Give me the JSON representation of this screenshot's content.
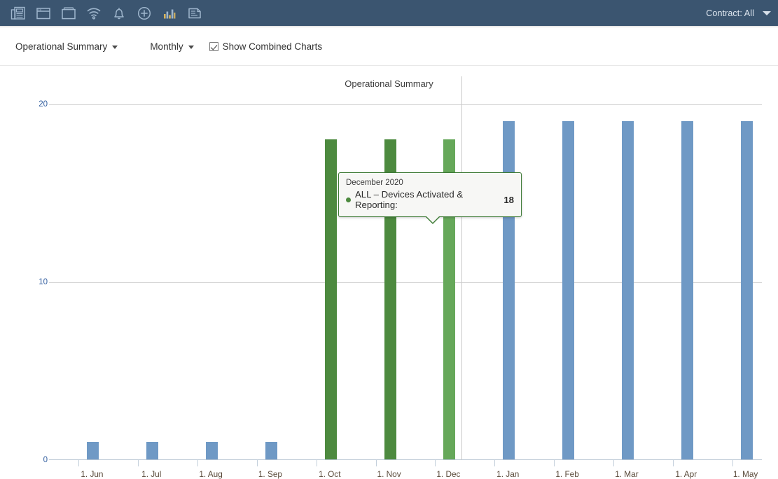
{
  "topbar": {
    "icons": [
      {
        "name": "report-icon",
        "label": "Reports"
      },
      {
        "name": "window-icon",
        "label": "Dashboard"
      },
      {
        "name": "folder-icon",
        "label": "Folders"
      },
      {
        "name": "wifi-icon",
        "label": "Connectivity"
      },
      {
        "name": "bell-icon",
        "label": "Alerts"
      },
      {
        "name": "plus-circle-icon",
        "label": "Add"
      },
      {
        "name": "bar-chart-icon",
        "label": "Charts"
      },
      {
        "name": "document-icon",
        "label": "Documents"
      }
    ],
    "contract_label": "Contract: All",
    "bg_color": "#3b5570"
  },
  "controls": {
    "report_select": "Operational Summary",
    "period_select": "Monthly",
    "combined_charts_label": "Show Combined Charts",
    "combined_charts_checked": true
  },
  "tooltip": {
    "date": "December 2020",
    "series": "ALL – Devices Activated & Reporting:",
    "value": "18",
    "dot_color": "#4d8a3f",
    "border_color": "#3c7a34"
  },
  "chart_data": {
    "type": "bar",
    "title": "Operational Summary",
    "xlabel": "",
    "ylabel": "",
    "ylim": [
      0,
      20
    ],
    "yticks": [
      0,
      10,
      20
    ],
    "ytick_labels": [
      "0",
      "10",
      "20"
    ],
    "grid": true,
    "legend": "none",
    "categories": [
      "1. Jun",
      "1. Jul",
      "1. Aug",
      "1. Sep",
      "1. Oct",
      "1. Nov",
      "1. Dec",
      "1. Jan",
      "1. Feb",
      "1. Mar",
      "1. Apr",
      "1. May"
    ],
    "series": [
      {
        "name": "ALL – Devices Activated & Reporting",
        "color": "#6f99c5",
        "values": [
          1,
          1,
          1,
          1,
          1,
          1,
          1,
          19,
          19,
          19,
          19,
          19
        ]
      },
      {
        "name": "ALL – Devices Activated & Reporting (green)",
        "color": "#4d8a3f",
        "values": [
          null,
          null,
          null,
          null,
          18,
          18,
          18,
          null,
          null,
          null,
          null,
          null
        ]
      }
    ],
    "highlighted_category": "1. Dec",
    "highlight_color": "#66a85a",
    "colors": {
      "blue": "#6f99c5",
      "green": "#4d8a3f",
      "green_highlight": "#66a85a"
    }
  }
}
